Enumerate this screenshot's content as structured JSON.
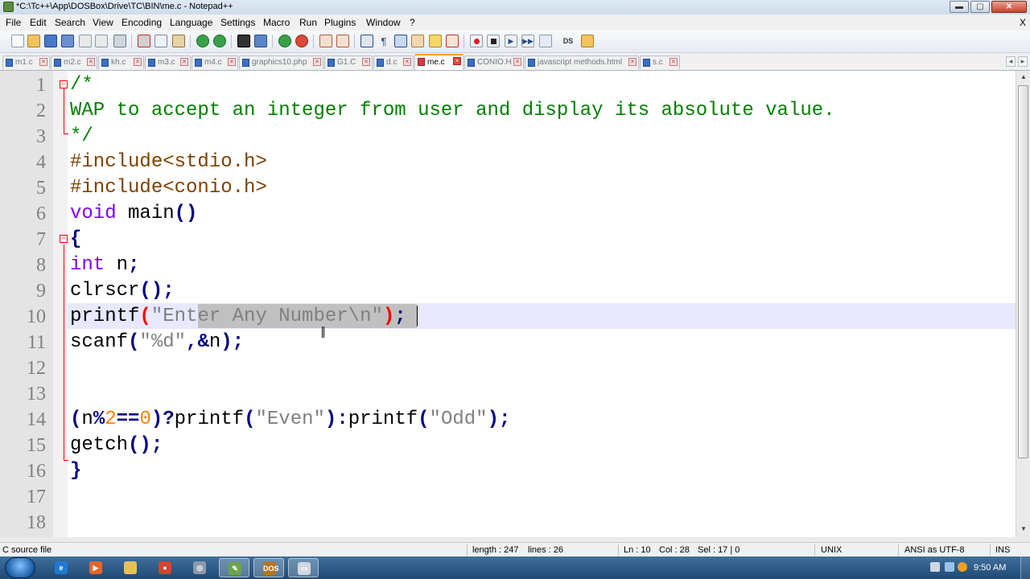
{
  "window": {
    "title": "*C:\\Tc++\\App\\DOSBox\\Drive\\TC\\BIN\\me.c - Notepad++",
    "minimize": "▬",
    "maximize": "▢",
    "close": "✕"
  },
  "menu": {
    "items": [
      "File",
      "Edit",
      "Search",
      "View",
      "Encoding",
      "Language",
      "Settings",
      "Macro",
      "Run",
      "Plugins",
      "Window",
      "?"
    ],
    "close_label": "X"
  },
  "tabs": [
    {
      "label": "m1.c",
      "active": false
    },
    {
      "label": "m2.c",
      "active": false
    },
    {
      "label": "kh.c",
      "active": false
    },
    {
      "label": "m3.c",
      "active": false
    },
    {
      "label": "m4.c",
      "active": false
    },
    {
      "label": "graphics10.php",
      "active": false
    },
    {
      "label": "G1.C",
      "active": false
    },
    {
      "label": "d.c",
      "active": false
    },
    {
      "label": "me.c",
      "active": true
    },
    {
      "label": "CONIO.H",
      "active": false
    },
    {
      "label": "javascript methods.html",
      "active": false
    },
    {
      "label": "s.c",
      "active": false
    }
  ],
  "tab_scroll": {
    "left": "◂",
    "right": "▸"
  },
  "editor": {
    "line_numbers": [
      "1",
      "2",
      "3",
      "4",
      "5",
      "6",
      "7",
      "8",
      "9",
      "10",
      "11",
      "12",
      "13",
      "14",
      "15",
      "16",
      "17",
      "18"
    ],
    "lines": [
      "/*",
      "WAP to accept an integer from user and display its absolute value.",
      "*/",
      "#include<stdio.h>",
      "#include<conio.h>",
      "void main()",
      "{",
      "int n;",
      "clrscr();",
      "printf(\"Enter Any Number\\n\");",
      "scanf(\"%d\",&n);",
      "",
      "",
      "(n%2==0)?printf(\"Even\"):printf(\"Odd\");",
      "getch();",
      "}",
      "",
      ""
    ],
    "current_line": 10
  },
  "status": {
    "file_type": "C source file",
    "length": "length : 247",
    "lines": "lines : 26",
    "ln": "Ln : 10",
    "col": "Col : 28",
    "sel": "Sel : 17 | 0",
    "eol": "UNIX",
    "encoding": "ANSI as UTF-8",
    "mode": "INS"
  },
  "taskbar": {
    "clock": "9:50 AM",
    "apps": [
      {
        "name": "internet-explorer-icon",
        "color": "#1f7ad6",
        "glyph": "e"
      },
      {
        "name": "media-player-icon",
        "color": "#e8642a",
        "glyph": "▶"
      },
      {
        "name": "file-explorer-icon",
        "color": "#e8c05a",
        "glyph": ""
      },
      {
        "name": "chrome-icon",
        "color": "#d9412f",
        "glyph": "●"
      },
      {
        "name": "app-icon",
        "color": "#8a9aab",
        "glyph": "◎"
      },
      {
        "name": "notepad-plus-plus-icon",
        "color": "#6aa54a",
        "glyph": "✎"
      },
      {
        "name": "dosbox-icon",
        "color": "#b8741a",
        "glyph": "DOS"
      },
      {
        "name": "window-icon",
        "color": "#d0d6df",
        "glyph": "▭"
      }
    ]
  },
  "colors": {
    "comment": "#008000",
    "preprocessor": "#804000",
    "type_keyword": "#8000ff",
    "operator": "#000080",
    "string": "#808080",
    "number": "#ff8000",
    "current_line_bg": "#e8e8ff",
    "selection": "#c0c0c0"
  }
}
